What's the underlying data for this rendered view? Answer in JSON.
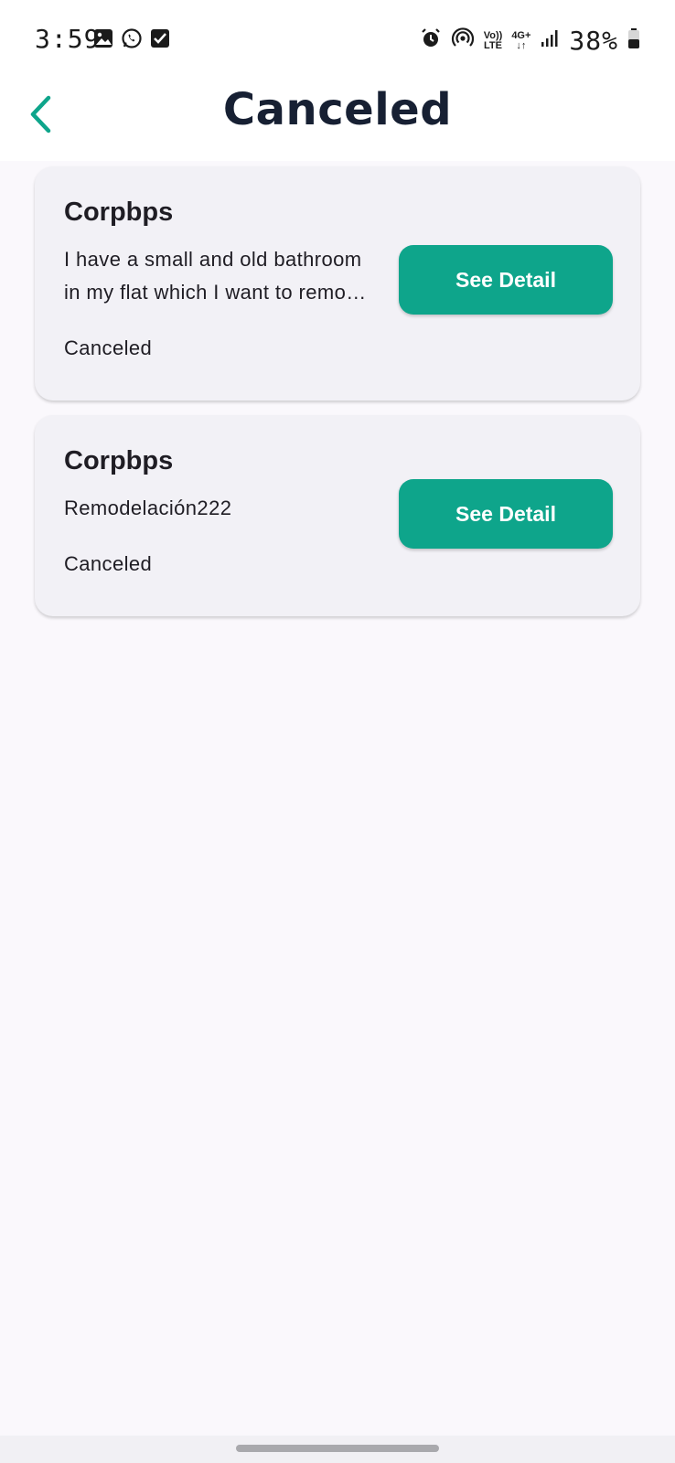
{
  "status_bar": {
    "time": "3:59",
    "network_top": "Vo))",
    "network_bottom": "LTE",
    "data_top": "4G+",
    "data_bottom": "↓↑",
    "battery": "38%"
  },
  "header": {
    "title": "Canceled"
  },
  "cards": [
    {
      "title": "Corpbps",
      "description": "I have a small and old bathroom\nin my flat which I want to remo…",
      "button_label": "See Detail",
      "status": "Canceled"
    },
    {
      "title": "Corpbps",
      "description": "Remodelación222",
      "button_label": "See Detail",
      "status": "Canceled"
    }
  ],
  "colors": {
    "accent": "#0ea58b",
    "title": "#172033",
    "card_background": "#f2f1f6",
    "page_background": "#faf8fc"
  },
  "icons": {
    "status_left": [
      "gallery-icon",
      "whatsapp-icon",
      "checkbox-icon"
    ],
    "status_right": [
      "alarm-icon",
      "hotspot-icon",
      "signal-icon",
      "battery-icon"
    ],
    "back": "chevron-left-icon"
  }
}
